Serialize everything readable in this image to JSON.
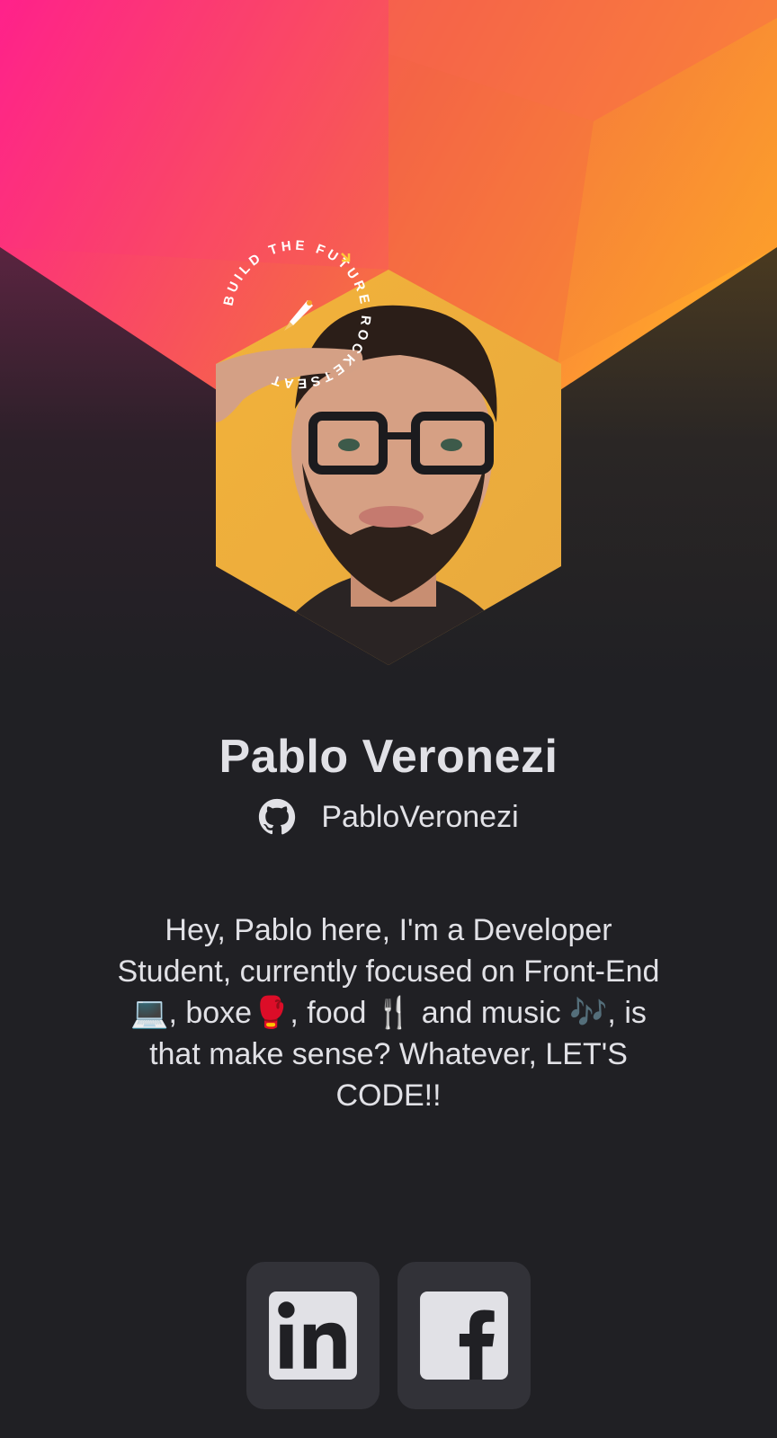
{
  "profile": {
    "name": "Pablo Veronezi",
    "github_username": "PabloVeronezi",
    "bio": "Hey, Pablo here, I'm a Developer Student, currently focused on Front-End💻, boxe🥊, food 🍴 and music 🎶, is that make sense? Whatever, LET'S CODE!!"
  },
  "stamp": {
    "text": "BUILD THE FUTURE  ROCKETSEAT"
  },
  "socials": [
    {
      "label": "LinkedIn",
      "icon": "linkedin-icon"
    },
    {
      "label": "Facebook",
      "icon": "facebook-icon"
    }
  ],
  "colors": {
    "background": "#202024",
    "text": "#E1E1E6",
    "button": "#323238",
    "gradient_start": "#FF2A8A",
    "gradient_end": "#FFA62B"
  }
}
